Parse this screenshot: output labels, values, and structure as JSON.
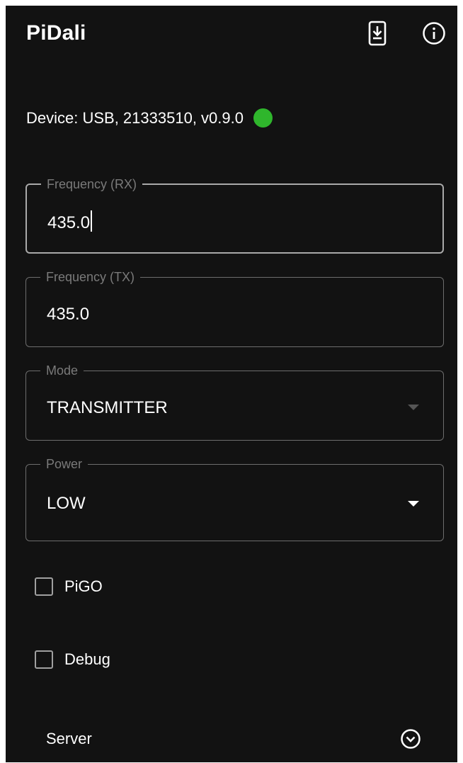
{
  "app": {
    "title": "PiDali"
  },
  "icons": {
    "download": "phone-download-icon",
    "info": "info-icon",
    "expand": "chevron-down-circle-icon"
  },
  "device": {
    "status_text": "Device: USB, 21333510, v0.9.0",
    "status_color": "#2fb62c"
  },
  "fields": {
    "freq_rx": {
      "label": "Frequency (RX)",
      "value": "435.0"
    },
    "freq_tx": {
      "label": "Frequency (TX)",
      "value": "435.0"
    },
    "mode": {
      "label": "Mode",
      "value": "TRANSMITTER"
    },
    "power": {
      "label": "Power",
      "value": "LOW"
    }
  },
  "checkboxes": {
    "pigo": {
      "label": "PiGO",
      "checked": false
    },
    "debug": {
      "label": "Debug",
      "checked": false
    }
  },
  "server": {
    "label": "Server"
  }
}
